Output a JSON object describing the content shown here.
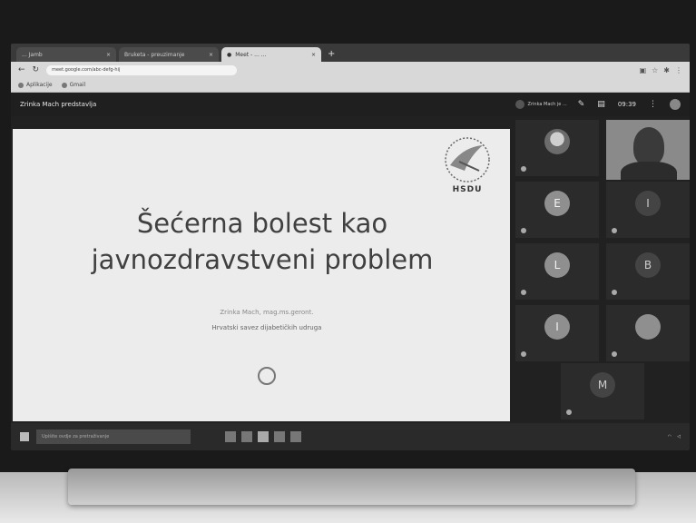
{
  "browser": {
    "tabs": [
      {
        "label": "... Jamb"
      },
      {
        "label": "Bruketa - preuzimanje"
      },
      {
        "label": "Meet - ... ..."
      }
    ],
    "url": "meet.google.com/abc-defg-hij",
    "bookmarks": [
      {
        "label": "Aplikacije"
      },
      {
        "label": "Gmail"
      }
    ]
  },
  "meet": {
    "presenter_title": "Zrinka Mach predstavlja",
    "presenting_chip": "Zrinka Mach je ...",
    "clock": "09:39"
  },
  "slide": {
    "title_line1": "Šećerna bolest kao",
    "title_line2": "javnozdravstveni problem",
    "author": "Zrinka Mach, mag.ms.geront.",
    "organization": "Hrvatski savez dijabetičkih udruga",
    "logo_text": "HSDU"
  },
  "participants": [
    {
      "initial": "",
      "name": "",
      "style": "photo"
    },
    {
      "initial": "E",
      "name": "",
      "style": "light"
    },
    {
      "initial": "I",
      "name": "",
      "style": "dark"
    },
    {
      "initial": "L",
      "name": "",
      "style": "light"
    },
    {
      "initial": "B",
      "name": "",
      "style": "dark"
    },
    {
      "initial": "I",
      "name": "",
      "style": "light"
    },
    {
      "initial": "",
      "name": "",
      "style": "light"
    },
    {
      "initial": "M",
      "name": "",
      "style": "dark"
    }
  ],
  "taskbar": {
    "search_placeholder": "Upišite ovdje za pretraživanje"
  },
  "icons": {
    "back": "back-icon",
    "reload": "reload-icon",
    "mic_off": "mic-off-icon"
  }
}
